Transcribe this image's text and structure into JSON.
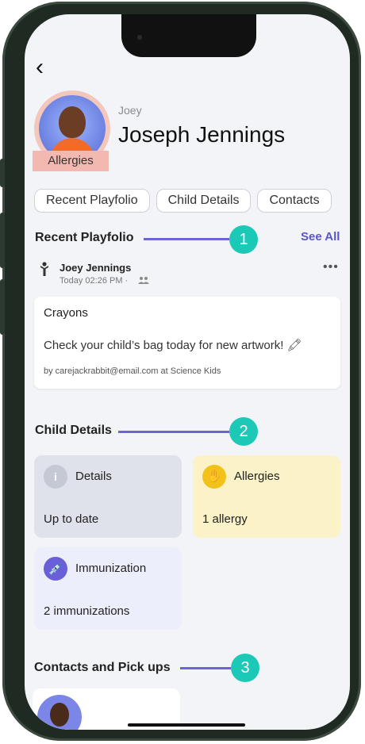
{
  "header": {
    "back_icon": "chevron-left-icon",
    "back_glyph": "‹"
  },
  "profile": {
    "nickname": "Joey",
    "full_name": "Joseph Jennings",
    "badge": "Allergies"
  },
  "tabs": [
    {
      "label": "Recent Playfolio"
    },
    {
      "label": "Child Details"
    },
    {
      "label": "Contacts"
    }
  ],
  "recent_playfolio": {
    "title": "Recent Playfolio",
    "see_all": "See All",
    "callout": "1",
    "post": {
      "author": "Joey Jennings",
      "time": "Today 02:26 PM ·",
      "more": "•••",
      "card_title": "Crayons",
      "body": "Check your child’s bag today for new artwork! 🖍",
      "footer": "by carejackrabbit@email.com at Science Kids"
    }
  },
  "child_details": {
    "title": "Child Details",
    "callout": "2",
    "tiles": [
      {
        "label": "Details",
        "value": "Up to date",
        "icon": "info-icon",
        "icon_glyph": "i"
      },
      {
        "label": "Allergies",
        "value": "1 allergy",
        "icon": "hand-icon",
        "icon_glyph": "✋"
      },
      {
        "label": "Immunization",
        "value": "2 immunizations",
        "icon": "syringe-icon",
        "icon_glyph": "💉"
      }
    ]
  },
  "contacts": {
    "title": "Contacts and Pick ups",
    "callout": "3"
  },
  "colors": {
    "accent": "#5a55c9",
    "callout": "#1bc9b6",
    "callout_line": "#6b63d6",
    "badge_bg": "#f3b9b1",
    "details_tile": "#dfe2ea",
    "allergies_tile": "#fbf2c8",
    "immunization_tile": "#eceefb"
  }
}
